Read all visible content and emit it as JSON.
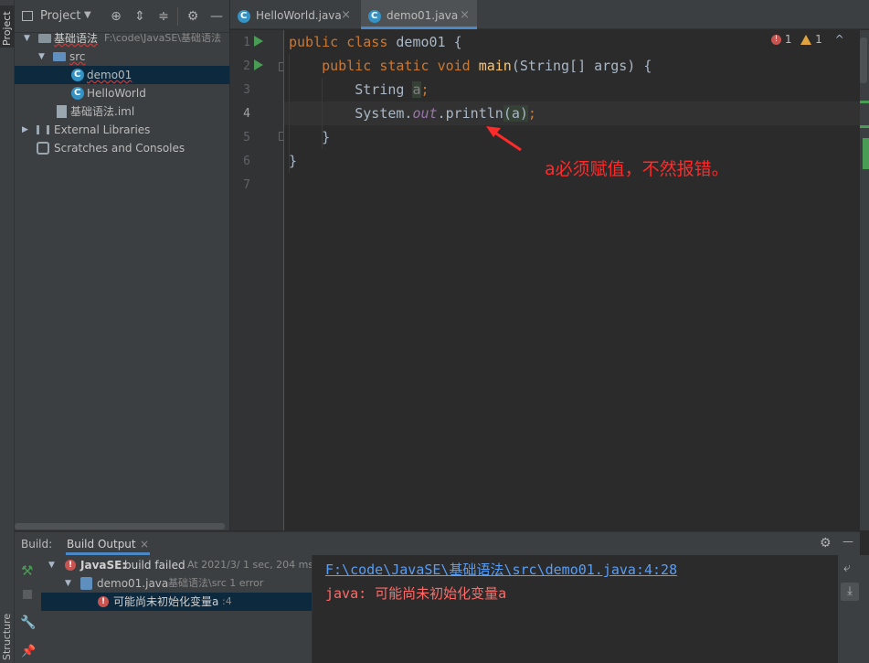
{
  "left_strip": {
    "project_tab": "Project",
    "structure_tab": "Structure"
  },
  "project_panel": {
    "title": "Project",
    "tree": [
      {
        "label": "基础语法",
        "path": "F:\\code\\JavaSE\\基础语法"
      },
      {
        "label": "src"
      },
      {
        "label": "demo01"
      },
      {
        "label": "HelloWorld"
      },
      {
        "label": "基础语法.iml"
      },
      {
        "label": "External Libraries"
      },
      {
        "label": "Scratches and Consoles"
      }
    ]
  },
  "editor": {
    "tabs": [
      {
        "label": "HelloWorld.java"
      },
      {
        "label": "demo01.java"
      }
    ],
    "line_numbers": [
      "1",
      "2",
      "3",
      "4",
      "5",
      "6",
      "7"
    ],
    "code": {
      "l1_kw1": "public",
      "l1_kw2": "class",
      "l1_rest": " demo01 {",
      "l2_kw1": "public",
      "l2_kw2": "static",
      "l2_kw3": "void",
      "l2_fn": "main",
      "l2_rest": "(String[] args) {",
      "l3_type": "String ",
      "l3_var": "a",
      "l3_end": ";",
      "l4_obj": "System.",
      "l4_field": "out",
      "l4_call": ".println",
      "l4_arg": "(a)",
      "l4_end": ";",
      "l5": "}",
      "l6": "}"
    },
    "inspections": {
      "errors": "1",
      "warnings": "1"
    },
    "annotation": "a必须赋值，不然报错。"
  },
  "build": {
    "label": "Build:",
    "tab": "Build Output",
    "tree": {
      "root_name": "JavaSE:",
      "root_status": " build failed",
      "root_time": "At 2021/3/ 1 sec, 204 ms",
      "file": "demo01.java",
      "file_meta": "基础语法\\src 1 error",
      "error": "可能尚未初始化变量a",
      "error_loc": ":4"
    },
    "output": {
      "link": "F:\\code\\JavaSE\\基础语法\\src\\demo01.java:4:28",
      "message": "java: 可能尚未初始化变量a"
    }
  }
}
